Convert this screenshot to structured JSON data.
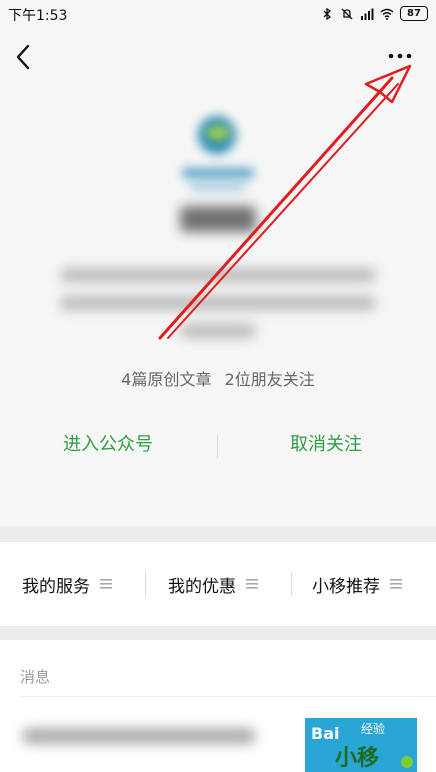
{
  "status_bar": {
    "time": "下午1:53",
    "battery": "87",
    "icons": [
      "bluetooth-icon",
      "mute-icon",
      "signal-icon",
      "wifi-icon",
      "battery-icon"
    ]
  },
  "header": {
    "back_icon": "back-chevron-icon",
    "more_icon": "more-dots-icon"
  },
  "profile": {
    "stats_articles": "4篇原创文章",
    "stats_friends": "2位朋友关注",
    "action_enter": "进入公众号",
    "action_unfollow": "取消关注"
  },
  "menu": {
    "items": [
      {
        "label": "我的服务"
      },
      {
        "label": "我的优惠"
      },
      {
        "label": "小移推荐"
      }
    ]
  },
  "messages": {
    "section_label": "消息",
    "thumbnail": {
      "brand": "Bai",
      "sub": "经验",
      "headline": "小移"
    }
  },
  "colors": {
    "accent_green": "#2f9e44",
    "annotation_red": "#e01e1e",
    "background_gray": "#f6f6f6"
  }
}
